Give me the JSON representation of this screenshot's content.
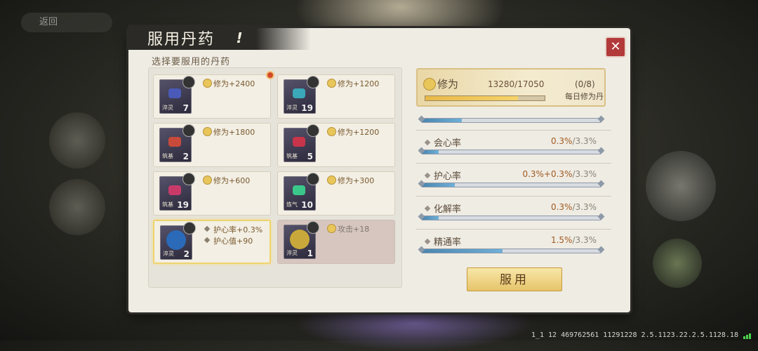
{
  "window": {
    "title": "服用丹药",
    "title_icon": "!"
  },
  "background": {
    "back_hint": "返回"
  },
  "list": {
    "title": "选择要服用的丹药",
    "items": [
      {
        "icon": "pill-blue-icon",
        "tag": "淬灵",
        "count": "7",
        "effect": "修为+2400",
        "color": "#4a5ab8"
      },
      {
        "icon": "pill-teal-icon",
        "tag": "淬灵",
        "count": "19",
        "effect": "修为+1200",
        "color": "#3aa8b8"
      },
      {
        "icon": "pill-red-icon",
        "tag": "筑基",
        "count": "2",
        "effect": "修为+1800",
        "color": "#c84a3a"
      },
      {
        "icon": "pill-crimson-icon",
        "tag": "筑基",
        "count": "5",
        "effect": "修为+1200",
        "color": "#c8344a"
      },
      {
        "icon": "pill-magenta-icon",
        "tag": "筑基",
        "count": "19",
        "effect": "修为+600",
        "color": "#c83a6a"
      },
      {
        "icon": "pill-green-icon",
        "tag": "炼气",
        "count": "10",
        "effect": "修为+300",
        "color": "#3ac88a"
      },
      {
        "icon": "orb-blue-icon",
        "tag": "淬灵",
        "count": "2",
        "effect": "护心率+0.3%",
        "effect2": "护心值+90",
        "color": "#2a6ab8"
      },
      {
        "icon": "orb-gold-icon",
        "tag": "淬灵",
        "count": "1",
        "effect": "攻击+18",
        "color": "#c8a83a"
      }
    ]
  },
  "xiuwei": {
    "label": "修为",
    "value": "13280/17050",
    "progress": 0.779,
    "daily_count": "(0/8)",
    "daily_label": "每日修为丹"
  },
  "top_bar_progress": 0.22,
  "stats": [
    {
      "label": "会心率",
      "value": "0.3%",
      "max": "/3.3%",
      "progress": 0.09
    },
    {
      "label": "护心率",
      "value": "0.3%+0.3%",
      "max": "/3.3%",
      "progress": 0.18
    },
    {
      "label": "化解率",
      "value": "0.3%",
      "max": "/3.3%",
      "progress": 0.09
    },
    {
      "label": "精通率",
      "value": "1.5%",
      "max": "/3.3%",
      "progress": 0.45
    }
  ],
  "take_button": "服用",
  "status_bar": "1_1 12 469762561 11291228 2.5.1123.22.2.5.1128.18"
}
